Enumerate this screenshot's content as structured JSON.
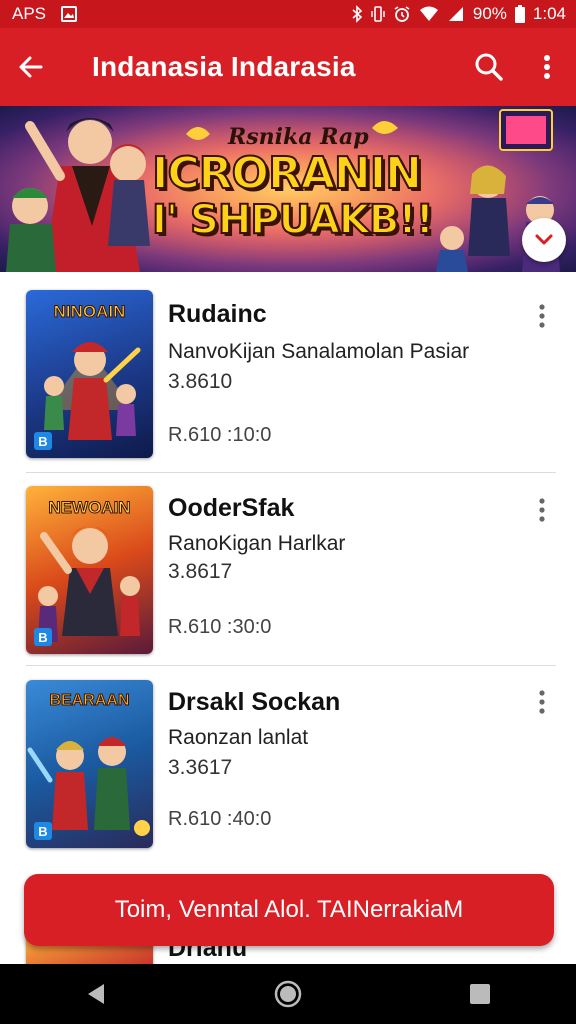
{
  "status_bar": {
    "left_text": "APS",
    "battery": "90%",
    "time": "1:04",
    "icons": [
      "image-notification-icon",
      "bluetooth-icon",
      "vibrate-icon",
      "alarm-icon",
      "wifi-icon",
      "signal-icon",
      "battery-icon"
    ]
  },
  "app_bar": {
    "title": "Indanasia  Indarasia",
    "icons": [
      "back-arrow-icon",
      "search-icon",
      "more-vert-icon"
    ]
  },
  "banner": {
    "tagline": "Rsnika Rap",
    "headline_line1": "ICRORANIN",
    "headline_line2": "I' SHPUAKB!!",
    "collapse_icon": "chevron-down-icon"
  },
  "items": [
    {
      "thumb_title": "NINOAIN",
      "name": "Rudainc",
      "subtitle": "NanvoKijan Sanalamolan Pasiar",
      "rating": "3.8610",
      "price": "R.610 :10:0",
      "colors": {
        "bg": "#1c4aa8",
        "accent": "#ffb21a"
      }
    },
    {
      "thumb_title": "NEWOAIN",
      "name": "OoderSfak",
      "subtitle": "RanoKigan Harlkar",
      "rating": "3.8617",
      "price": "R.610 :30:0",
      "colors": {
        "bg": "#d9491a",
        "accent": "#ffd24a"
      }
    },
    {
      "thumb_title": "BEARAAN",
      "name": "Drsakl Sockan",
      "subtitle": "Raonzan lanlat",
      "rating": "3.3617",
      "price": "R.610 :40:0",
      "colors": {
        "bg": "#1a5aa0",
        "accent": "#ffb21a"
      }
    }
  ],
  "partial_item": {
    "name": "Drlanu"
  },
  "cta": {
    "label": "Toim, Venntal Alol. TAINerrakiaM"
  },
  "nav_bar": {
    "icons": [
      "back-triangle-icon",
      "home-circle-icon",
      "recents-square-icon"
    ]
  },
  "colors": {
    "primary": "#d71f25",
    "status_bar": "#c8161d",
    "headline": "#ffd21a"
  }
}
